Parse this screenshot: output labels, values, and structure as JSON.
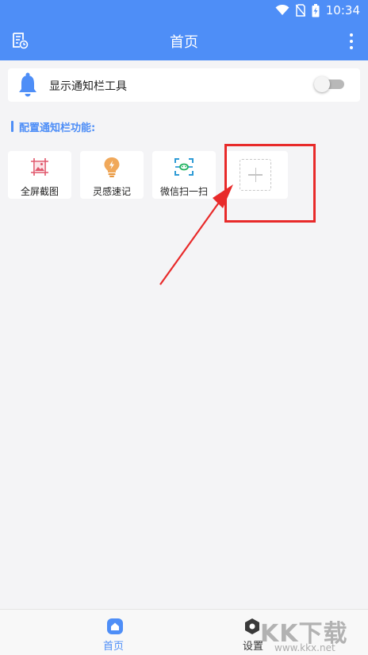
{
  "status_bar": {
    "time": "10:34"
  },
  "app_bar": {
    "title": "首页"
  },
  "notify_toggle": {
    "label": "显示通知栏工具",
    "enabled": false
  },
  "section": {
    "title": "配置通知栏功能:"
  },
  "tiles": [
    {
      "label": "全屏截图",
      "icon": "screenshot-icon"
    },
    {
      "label": "灵感速记",
      "icon": "lightbulb-icon"
    },
    {
      "label": "微信扫一扫",
      "icon": "scan-icon"
    }
  ],
  "add_tile": {
    "icon": "add-icon"
  },
  "bottom_nav": {
    "items": [
      {
        "label": "首页",
        "icon": "home-icon",
        "active": true
      },
      {
        "label": "设置",
        "icon": "settings-icon",
        "active": false
      }
    ]
  },
  "watermark": {
    "text": "KK下载",
    "sub": "www.kkx.net"
  },
  "colors": {
    "primary": "#4e8ef7",
    "highlight": "#e82a2a"
  }
}
